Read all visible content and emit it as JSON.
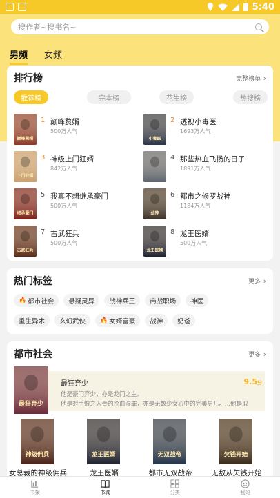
{
  "status_bar": {
    "time": "5:40"
  },
  "search": {
    "placeholder": "搜作者~搜书名~"
  },
  "channels": [
    {
      "label": "男频",
      "active": true
    },
    {
      "label": "女频",
      "active": false
    }
  ],
  "ranking": {
    "title": "排行榜",
    "more": "完整榜单",
    "tabs": [
      {
        "label": "推荐榜",
        "active": true
      },
      {
        "label": "完本榜"
      },
      {
        "label": "花生榜"
      },
      {
        "label": "热搜榜"
      }
    ],
    "items": [
      {
        "rank": "1",
        "title": "巅峰赘婿",
        "popularity": "500万人气",
        "cover_text": "巅峰赘婿",
        "cover_color": "#8a3a2a"
      },
      {
        "rank": "2",
        "title": "透视小毒医",
        "popularity": "1693万人气",
        "cover_text": "小毒医",
        "cover_color": "#2a3446"
      },
      {
        "rank": "3",
        "title": "神级上门狂婿",
        "popularity": "842万人气",
        "cover_text": "上门狂婿",
        "cover_color": "#c9a070"
      },
      {
        "rank": "4",
        "title": "那些热血飞扬的日子",
        "popularity": "1891万人气",
        "cover_text": "",
        "cover_color": "#5c6470"
      },
      {
        "rank": "5",
        "title": "我真不想继承豪门",
        "popularity": "500万人气",
        "cover_text": "继承豪门",
        "cover_color": "#7a1f1a"
      },
      {
        "rank": "6",
        "title": "都市之修罗战神",
        "popularity": "1184万人气",
        "cover_text": "战神",
        "cover_color": "#3a3028"
      },
      {
        "rank": "7",
        "title": "古武狂兵",
        "popularity": "500万人气",
        "cover_text": "古武狂兵",
        "cover_color": "#5a2a18"
      },
      {
        "rank": "8",
        "title": "龙王医婿",
        "popularity": "500万人气",
        "cover_text": "龙王医婿",
        "cover_color": "#1e2230"
      }
    ]
  },
  "hot_tags": {
    "title": "热门标签",
    "more": "更多",
    "row1": [
      {
        "label": "都市社会",
        "hot": true
      },
      {
        "label": "悬疑灵异"
      },
      {
        "label": "战神兵王"
      },
      {
        "label": "商战职场"
      },
      {
        "label": "神医"
      }
    ],
    "row2": [
      {
        "label": "重生异术"
      },
      {
        "label": "玄幻武侠"
      },
      {
        "label": "女婿富豪",
        "hot": true
      },
      {
        "label": "战神"
      },
      {
        "label": "奶爸"
      }
    ]
  },
  "dushi": {
    "title": "都市社会",
    "more": "更多",
    "featured": {
      "title": "最狂弃少",
      "score": "9.5",
      "score_unit": "分",
      "desc1": "他是豪门弃少，亦是龙门之主。",
      "desc2": "他是对手恨之入骨的冷血湿罪，亦是无数少女心中的完美男儿。...他是取",
      "cover_text": "最狂弃少",
      "cover_color": "#6a2a3a"
    },
    "books": [
      {
        "title": "女总裁的神级佣兵",
        "cover_text": "神级佣兵",
        "cover_color": "#4a2218"
      },
      {
        "title": "龙王医婿",
        "cover_text": "龙王医婿",
        "cover_color": "#1e2230"
      },
      {
        "title": "都市无双战帝",
        "cover_text": "无双战帝",
        "cover_color": "#23344a"
      },
      {
        "title": "无敌从欠钱开始",
        "cover_text": "欠钱开始",
        "cover_color": "#3a2a1a"
      }
    ]
  },
  "bottom_nav": [
    {
      "label": "书架",
      "icon": "bookshelf-icon"
    },
    {
      "label": "书城",
      "icon": "book-open-icon",
      "active": true
    },
    {
      "label": "分类",
      "icon": "category-icon"
    },
    {
      "label": "我的",
      "icon": "profile-icon"
    }
  ],
  "colors": {
    "accent": "#f7c928",
    "header_bg": "#fce27a",
    "rank_hot": "#f08a2e"
  }
}
